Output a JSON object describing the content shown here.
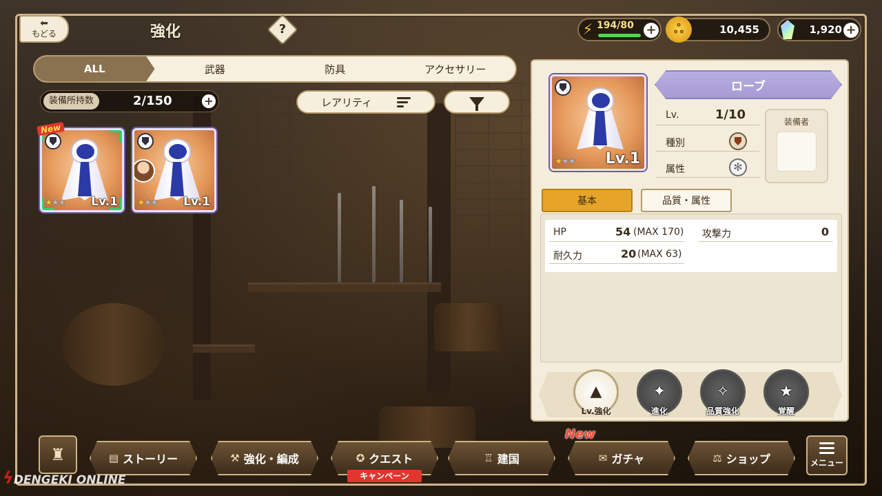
{
  "header": {
    "back_label": "もどる",
    "title": "強化",
    "help_label": "?"
  },
  "resources": {
    "stamina": {
      "current": 194,
      "max": 80,
      "text": "194/80",
      "fill_fraction": 1.0
    },
    "gold": {
      "text": "10,455"
    },
    "gems": {
      "text": "1,920"
    },
    "plus_label": "+"
  },
  "category_tabs": [
    {
      "label": "ALL",
      "active": true
    },
    {
      "label": "武器",
      "active": false
    },
    {
      "label": "防具",
      "active": false
    },
    {
      "label": "アクセサリー",
      "active": false
    }
  ],
  "owned": {
    "label": "装備所持数",
    "value": "2/150"
  },
  "sort": {
    "label": "レアリティ"
  },
  "items": [
    {
      "level": "Lv.1",
      "stars_on": "★",
      "stars_off": "★★",
      "new_label": "New",
      "selected": true,
      "equipped": false
    },
    {
      "level": "Lv.1",
      "stars_on": "★",
      "stars_off": "★★",
      "selected": false,
      "equipped": true
    }
  ],
  "detail": {
    "name": "ローブ",
    "thumb_level": "Lv.1",
    "lv_label": "Lv.",
    "lv_value": "1/10",
    "type_label": "種別",
    "attr_label": "属性",
    "equipper_label": "装備者",
    "tabs": {
      "basic": "基本",
      "quality": "品質・属性"
    },
    "stats": {
      "hp_label": "HP",
      "hp_value": "54",
      "hp_max": "(MAX 170)",
      "atk_label": "攻撃力",
      "atk_value": "0",
      "dur_label": "耐久力",
      "dur_value": "20",
      "dur_max": "(MAX 63)"
    },
    "actions": [
      {
        "label": "Lv.強化",
        "active": true
      },
      {
        "label": "進化",
        "active": false
      },
      {
        "label": "品質強化",
        "active": false
      },
      {
        "label": "覚醒",
        "active": false
      }
    ]
  },
  "nav": {
    "story": "ストーリー",
    "enhance": "強化・編成",
    "quest": "クエスト",
    "campaign": "キャンペーン",
    "kingdom": "建国",
    "gacha": "ガチャ",
    "gacha_new": "New",
    "shop": "ショップ",
    "menu": "メニュー"
  },
  "watermark": {
    "line1": "DENGEKI ONLINE"
  },
  "colors": {
    "accent_tab": "#8a7250",
    "basic_tab": "#e6a528",
    "name_banner": "#a69bd4",
    "selection": "#2fd06c",
    "campaign": "#e0362e"
  }
}
